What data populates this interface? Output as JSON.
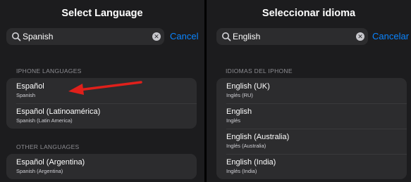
{
  "left_panel": {
    "title": "Select Language",
    "search": {
      "value": "Spanish",
      "icon": "search-icon"
    },
    "cancel_label": "Cancel",
    "iphone_section_label": "IPHONE LANGUAGES",
    "iphone_languages": [
      {
        "name": "Español",
        "subtitle": "Spanish"
      },
      {
        "name": "Español (Latinoamérica)",
        "subtitle": "Spanish (Latin America)"
      }
    ],
    "other_section_label": "OTHER LANGUAGES",
    "other_languages": [
      {
        "name": "Español (Argentina)",
        "subtitle": "Spanish (Argentina)"
      }
    ]
  },
  "right_panel": {
    "title": "Seleccionar idioma",
    "search": {
      "value": "English",
      "icon": "search-icon"
    },
    "cancel_label": "Cancelar",
    "iphone_section_label": "IDIOMAS DEL IPHONE",
    "iphone_languages": [
      {
        "name": "English (UK)",
        "subtitle": "Inglés (RU)"
      },
      {
        "name": "English",
        "subtitle": "Inglés"
      },
      {
        "name": "English (Australia)",
        "subtitle": "Inglés (Australia)"
      },
      {
        "name": "English (India)",
        "subtitle": "Inglés (India)"
      }
    ]
  },
  "annotation": {
    "type": "red-arrow",
    "color": "#e0201b"
  },
  "colors": {
    "background": "#1c1c1e",
    "cell": "#2c2c2e",
    "accent": "#0a84ff",
    "secondary_text": "#8e8e93"
  }
}
